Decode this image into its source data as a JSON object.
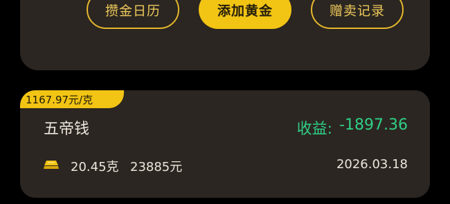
{
  "actions": {
    "calendar_label": "攒金日历",
    "add_label": "添加黄金",
    "record_label": "赠卖记录"
  },
  "gold_item": {
    "price_tag": "1167.97元/克",
    "name": "五帝钱",
    "profit_label": "收益:",
    "profit_value": "-1897.36",
    "weight": "20.45克",
    "amount": "23885元",
    "date": "2026.03.18",
    "icon": "gold-bar-icon"
  },
  "colors": {
    "accent": "#f2c414",
    "card_bg": "#2b2621",
    "profit": "#2fcf86"
  }
}
